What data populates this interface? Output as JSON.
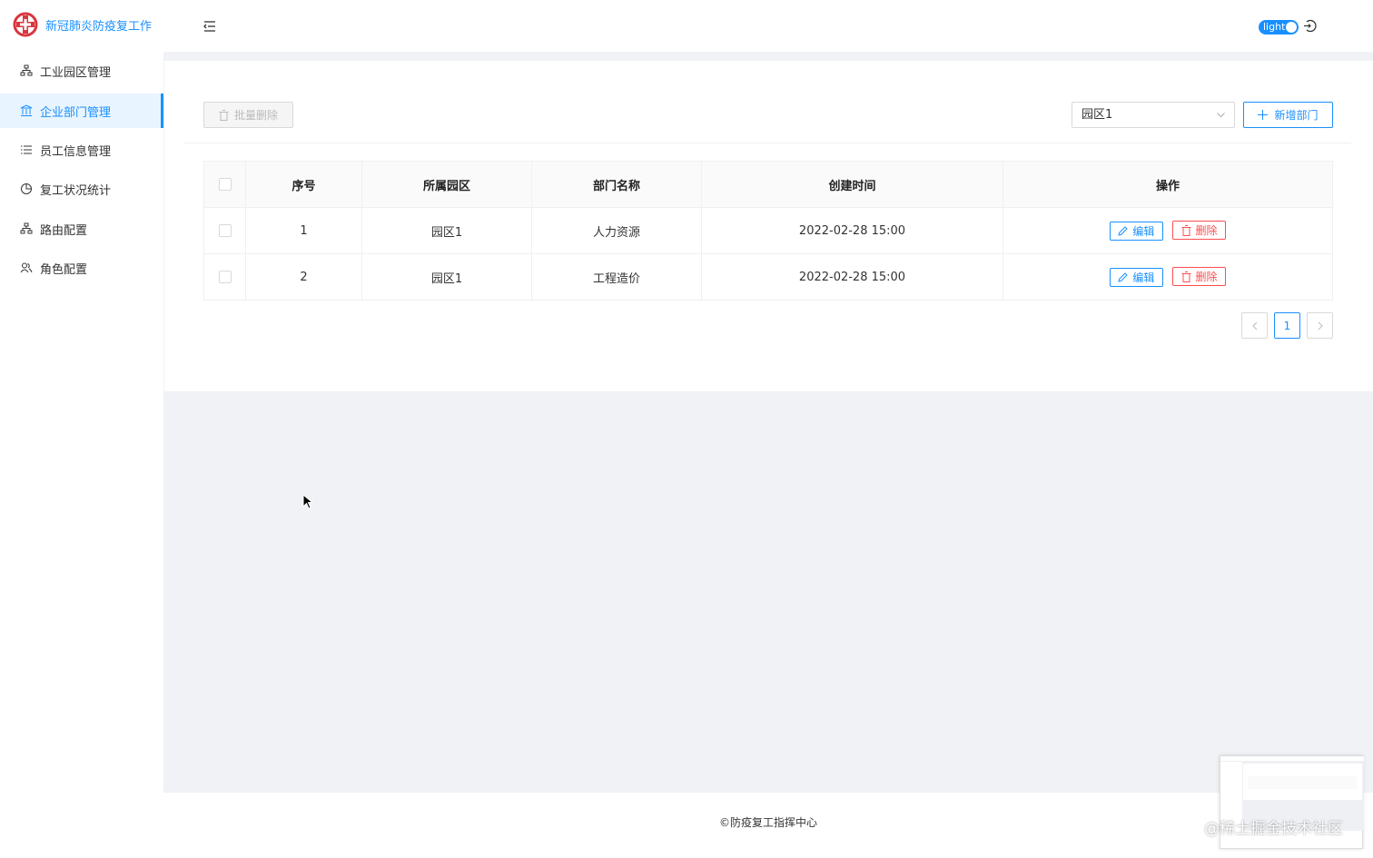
{
  "header": {
    "app_title": "新冠肺炎防疫复工作",
    "theme_label": "light",
    "colors": {
      "accent": "#1890ff",
      "danger": "#ff4d4f"
    }
  },
  "sidebar": {
    "items": [
      {
        "label": "工业园区管理",
        "icon": "sitemap-icon",
        "active": false
      },
      {
        "label": "企业部门管理",
        "icon": "bank-icon",
        "active": true
      },
      {
        "label": "员工信息管理",
        "icon": "list-icon",
        "active": false
      },
      {
        "label": "复工状况统计",
        "icon": "pie-chart-icon",
        "active": false
      },
      {
        "label": "路由配置",
        "icon": "sitemap-icon",
        "active": false
      },
      {
        "label": "角色配置",
        "icon": "user-group-icon",
        "active": false
      }
    ]
  },
  "toolbar": {
    "batch_delete_label": "批量删除",
    "park_select_value": "园区1",
    "add_dept_label": "新增部门"
  },
  "table": {
    "headers": [
      "序号",
      "所属园区",
      "部门名称",
      "创建时间",
      "操作"
    ],
    "rows": [
      {
        "index": "1",
        "park": "园区1",
        "dept": "人力资源",
        "created": "2022-02-28 15:00"
      },
      {
        "index": "2",
        "park": "园区1",
        "dept": "工程造价",
        "created": "2022-02-28 15:00"
      }
    ],
    "edit_label": "编辑",
    "delete_label": "删除"
  },
  "pagination": {
    "current_page": "1"
  },
  "footer": {
    "text": "©防疫复工指挥中心"
  },
  "watermark": "@稀土掘金技术社区"
}
